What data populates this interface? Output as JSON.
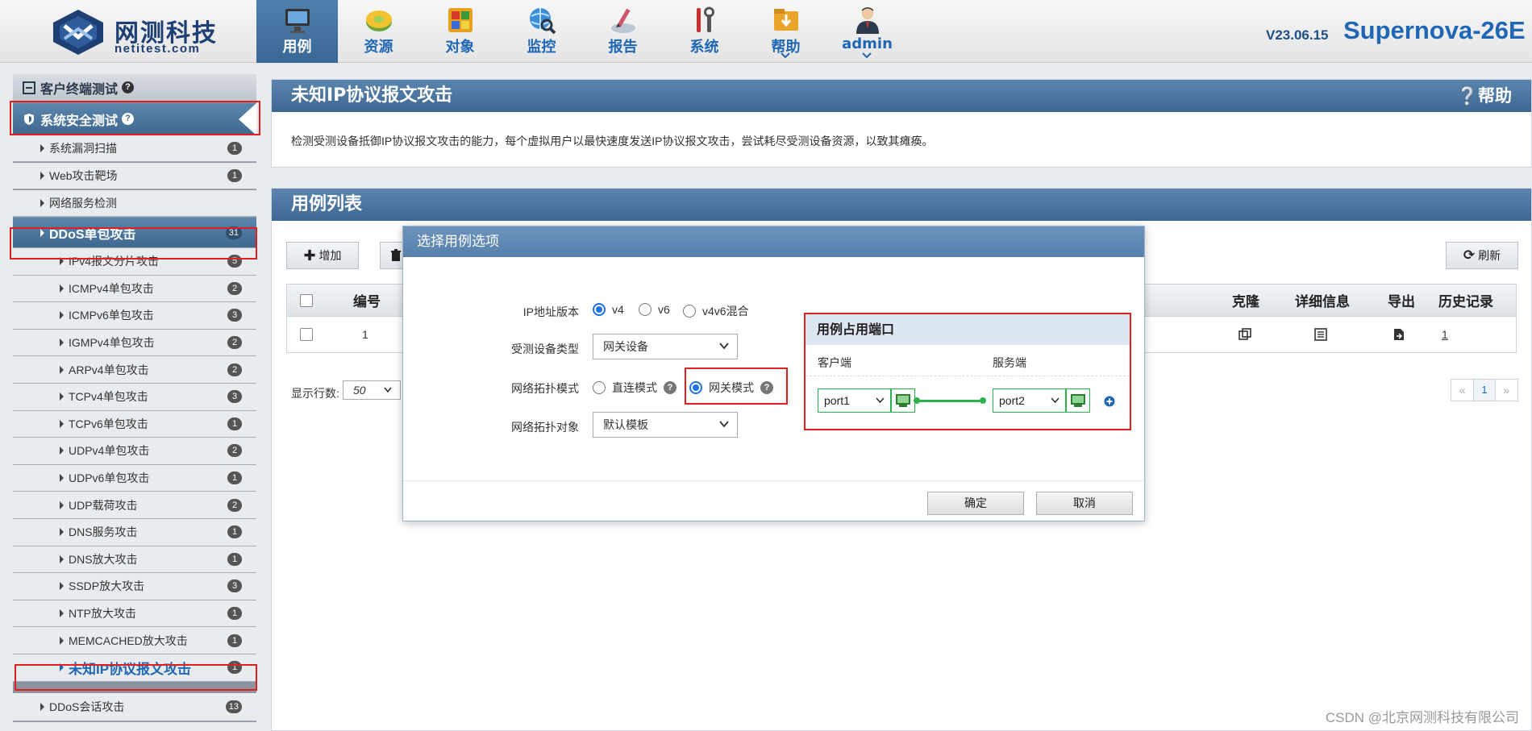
{
  "brand": {
    "logo_cn": "网测科技",
    "logo_en": "netitest.com",
    "version": "V23.06.15",
    "product": "Supernova-26E"
  },
  "nav": [
    {
      "label": "用例",
      "icon": "monitor-icon",
      "active": true
    },
    {
      "label": "资源",
      "icon": "resource-disc-icon"
    },
    {
      "label": "对象",
      "icon": "object-blocks-icon"
    },
    {
      "label": "监控",
      "icon": "monitor-globe-icon"
    },
    {
      "label": "报告",
      "icon": "report-pen-icon"
    },
    {
      "label": "系统",
      "icon": "system-tools-icon"
    },
    {
      "label": "帮助",
      "icon": "help-folder-icon",
      "dropdown": true
    },
    {
      "label": "admin",
      "icon": "user-avatar-icon",
      "dropdown": true
    }
  ],
  "sidebar": {
    "cat_client": "客户终端测试",
    "cat_security": "系统安全测试",
    "items": [
      {
        "label": "系统漏洞扫描",
        "count": "1"
      },
      {
        "label": "Web攻击靶场",
        "count": "1"
      },
      {
        "label": "网络服务检测",
        "count": ""
      },
      {
        "label": "DDoS单包攻击",
        "count": "31"
      }
    ],
    "subitems": [
      {
        "label": "IPv4报文分片攻击",
        "count": "5"
      },
      {
        "label": "ICMPv4单包攻击",
        "count": "2"
      },
      {
        "label": "ICMPv6单包攻击",
        "count": "3"
      },
      {
        "label": "IGMPv4单包攻击",
        "count": "2"
      },
      {
        "label": "ARPv4单包攻击",
        "count": "2"
      },
      {
        "label": "TCPv4单包攻击",
        "count": "3"
      },
      {
        "label": "TCPv6单包攻击",
        "count": "1"
      },
      {
        "label": "UDPv4单包攻击",
        "count": "2"
      },
      {
        "label": "UDPv6单包攻击",
        "count": "1"
      },
      {
        "label": "UDP载荷攻击",
        "count": "2"
      },
      {
        "label": "DNS服务攻击",
        "count": "1"
      },
      {
        "label": "DNS放大攻击",
        "count": "1"
      },
      {
        "label": "SSDP放大攻击",
        "count": "3"
      },
      {
        "label": "NTP放大攻击",
        "count": "1"
      },
      {
        "label": "MEMCACHED放大攻击",
        "count": "1"
      },
      {
        "label": "未知IP协议报文攻击",
        "count": "1"
      }
    ],
    "after": {
      "label": "DDoS会话攻击",
      "count": "13"
    }
  },
  "header_panel": {
    "title": "未知IP协议报文攻击",
    "help": "帮助",
    "description": "检测受测设备抵御IP协议报文攻击的能力，每个虚拟用户以最快速度发送IP协议报文攻击，尝试耗尽受测设备资源，以致其瘫痪。"
  },
  "list_panel": {
    "title": "用例列表",
    "add_label": "增加",
    "refresh_label": "刷新",
    "columns": {
      "id": "编号",
      "clone": "克隆",
      "detail": "详细信息",
      "export": "导出",
      "history": "历史记录"
    },
    "rows": [
      {
        "id": "1",
        "history": "1"
      }
    ],
    "rows_label": "显示行数:",
    "rows_value": "50",
    "page": "1"
  },
  "modal": {
    "title": "选择用例选项",
    "ip_version_label": "IP地址版本",
    "ip_versions": [
      "v4",
      "v6",
      "v4v6混合"
    ],
    "ip_version_selected": "v4",
    "device_type_label": "受测设备类型",
    "device_type_value": "网关设备",
    "topology_mode_label": "网络拓扑模式",
    "topology_modes": [
      "直连模式",
      "网关模式"
    ],
    "topology_mode_selected": "网关模式",
    "topology_object_label": "网络拓扑对象",
    "topology_object_value": "默认模板",
    "ports": {
      "title": "用例占用端口",
      "client_label": "客户端",
      "server_label": "服务端",
      "client_port": "port1",
      "server_port": "port2"
    },
    "confirm": "确定",
    "cancel": "取消"
  },
  "watermark": "CSDN @北京网测科技有限公司",
  "colors": {
    "accent": "#1f67b5",
    "highlight": "#e02020",
    "port_green": "#2bb24c"
  }
}
